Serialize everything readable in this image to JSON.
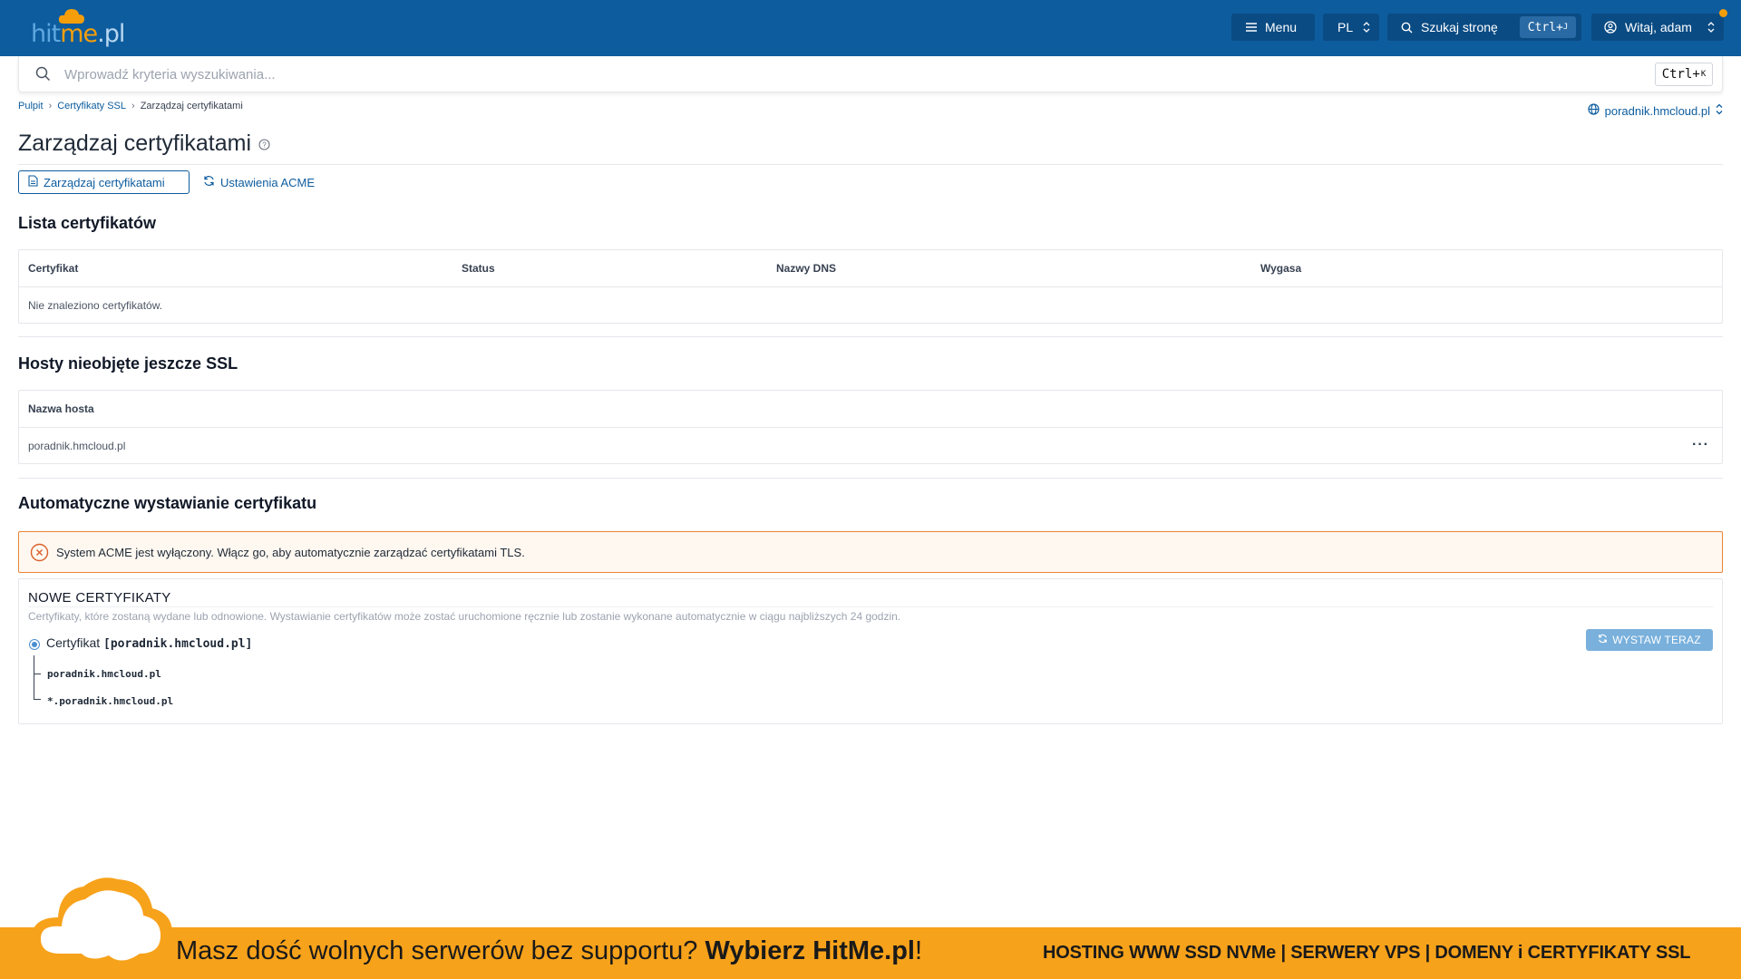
{
  "header": {
    "logo": {
      "text_hit": "hit",
      "text_me": "me",
      "text_pl": ".pl"
    },
    "menu_label": "Menu",
    "lang_label": "PL",
    "search_page_label": "Szukaj stronę",
    "search_page_shortcut": "Ctrl+",
    "search_page_shortcut_key": "J",
    "user_label": "Witaj, adam"
  },
  "search": {
    "placeholder": "Wprowadź kryteria wyszukiwania...",
    "shortcut": "Ctrl+",
    "shortcut_key": "K"
  },
  "breadcrumb": {
    "items": [
      "Pulpit",
      "Certyfikaty SSL",
      "Zarządzaj certyfikatami"
    ]
  },
  "domain_selector": "poradnik.hmcloud.pl",
  "page_title": "Zarządzaj certyfikatami",
  "tabs": [
    {
      "label": "Zarządzaj certyfikatami",
      "active": true
    },
    {
      "label": "Ustawienia ACME",
      "active": false
    }
  ],
  "cert_list": {
    "title": "Lista certyfikatów",
    "columns": [
      "Certyfikat",
      "Status",
      "Nazwy DNS",
      "Wygasa"
    ],
    "empty_text": "Nie znaleziono certyfikatów."
  },
  "hosts": {
    "title": "Hosty nieobjęte jeszcze SSL",
    "column": "Nazwa hosta",
    "rows": [
      "poradnik.hmcloud.pl"
    ],
    "menu_glyph": "···"
  },
  "auto": {
    "title": "Automatyczne wystawianie certyfikatu",
    "alert": "System ACME jest wyłączony. Włącz go, aby automatycznie zarządzać certyfikatami TLS.",
    "new_title": "NOWE CERTYFIKATY",
    "new_desc": "Certyfikaty, które zostaną wydane lub odnowione. Wystawianie certyfikatów może zostać uruchomione ręcznie lub zostanie wykonane automatycznie w ciągu najbliższych 24 godzin.",
    "cert_prefix": "Certyfikat",
    "cert_name": "[poradnik.hmcloud.pl]",
    "dns_names": [
      "poradnik.hmcloud.pl",
      "*.poradnik.hmcloud.pl"
    ],
    "issue_button": "WYSTAW TERAZ"
  },
  "banner": {
    "text_normal": "Masz dość wolnych serwerów bez supportu? ",
    "text_bold": "Wybierz HitMe.pl",
    "text_end": "!",
    "right": "HOSTING WWW SSD NVMe | SERWERY VPS | DOMENY i CERTYFIKATY SSL"
  },
  "colors": {
    "header_bg": "#0d5c9e",
    "accent": "#0d5c9e",
    "alert_border": "#e8853a",
    "banner_bg": "#f7a21b"
  }
}
